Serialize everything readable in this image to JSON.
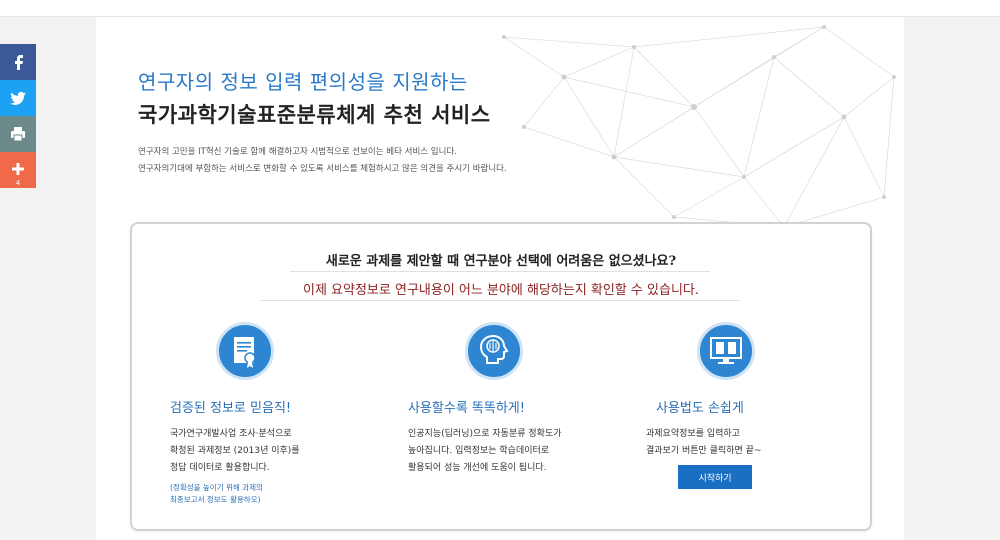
{
  "hero": {
    "subtitle": "연구자의 정보 입력 편의성을 지원하는",
    "title": "국가과학기술표준분류체계 추천 서비스",
    "description_lines": [
      "연구자의 고민을 IT혁신 기술로 함께 해결하고자 시범적으로 선보이는 베타 서비스 입니다.",
      "연구자의기대에 부합하는 서비스로 변화할 수 있도록 서비스를 체험하시고 많은 의견을 주시기 바랍니다."
    ]
  },
  "card": {
    "question": "새로운 과제를 제안할 때 연구분야 선택에 어려움은 없으셨나요?",
    "answer": "이제 요약정보로 연구내용이 어느 분야에 해당하는지 확인할 수 있습니다.",
    "features": [
      {
        "icon": "document-certificate-icon",
        "title": "검증된 정보로 믿음직!",
        "lines": [
          "국가연구개발사업 조사·분석으로",
          "확정된 과제정보 (2013년 이후)를",
          "정답 데이터로 활용합니다."
        ],
        "note_lines": [
          "(정확성을 높이기 위해 과제의",
          "최종보고서 정보도 활용하오)"
        ]
      },
      {
        "icon": "ai-brain-icon",
        "title": "사용할수록 똑똑하게!",
        "lines": [
          "인공지능(딥러닝)으로 자동분류 정확도가",
          "높아집니다. 입력정보는 학습데이터로",
          "활용되어 성능 개선에 도움이 됩니다."
        ]
      },
      {
        "icon": "monitor-book-icon",
        "title": "사용법도 손쉽게",
        "lines": [
          "과제요약정보를 입력하고",
          "결과보기 버튼만 클릭하면 끝~"
        ],
        "button_label": "시작하기"
      }
    ]
  },
  "share": {
    "print_label": "print",
    "more_count": "4",
    "colors": {
      "facebook": "#3b5998",
      "twitter": "#1da1f2",
      "print": "#6d8a8a",
      "more": "#f06a4a"
    }
  },
  "colors": {
    "accent": "#2a7ac7",
    "answer": "#8b2222",
    "button": "#1b6fc2",
    "icon_bg": "#2e86d2"
  }
}
